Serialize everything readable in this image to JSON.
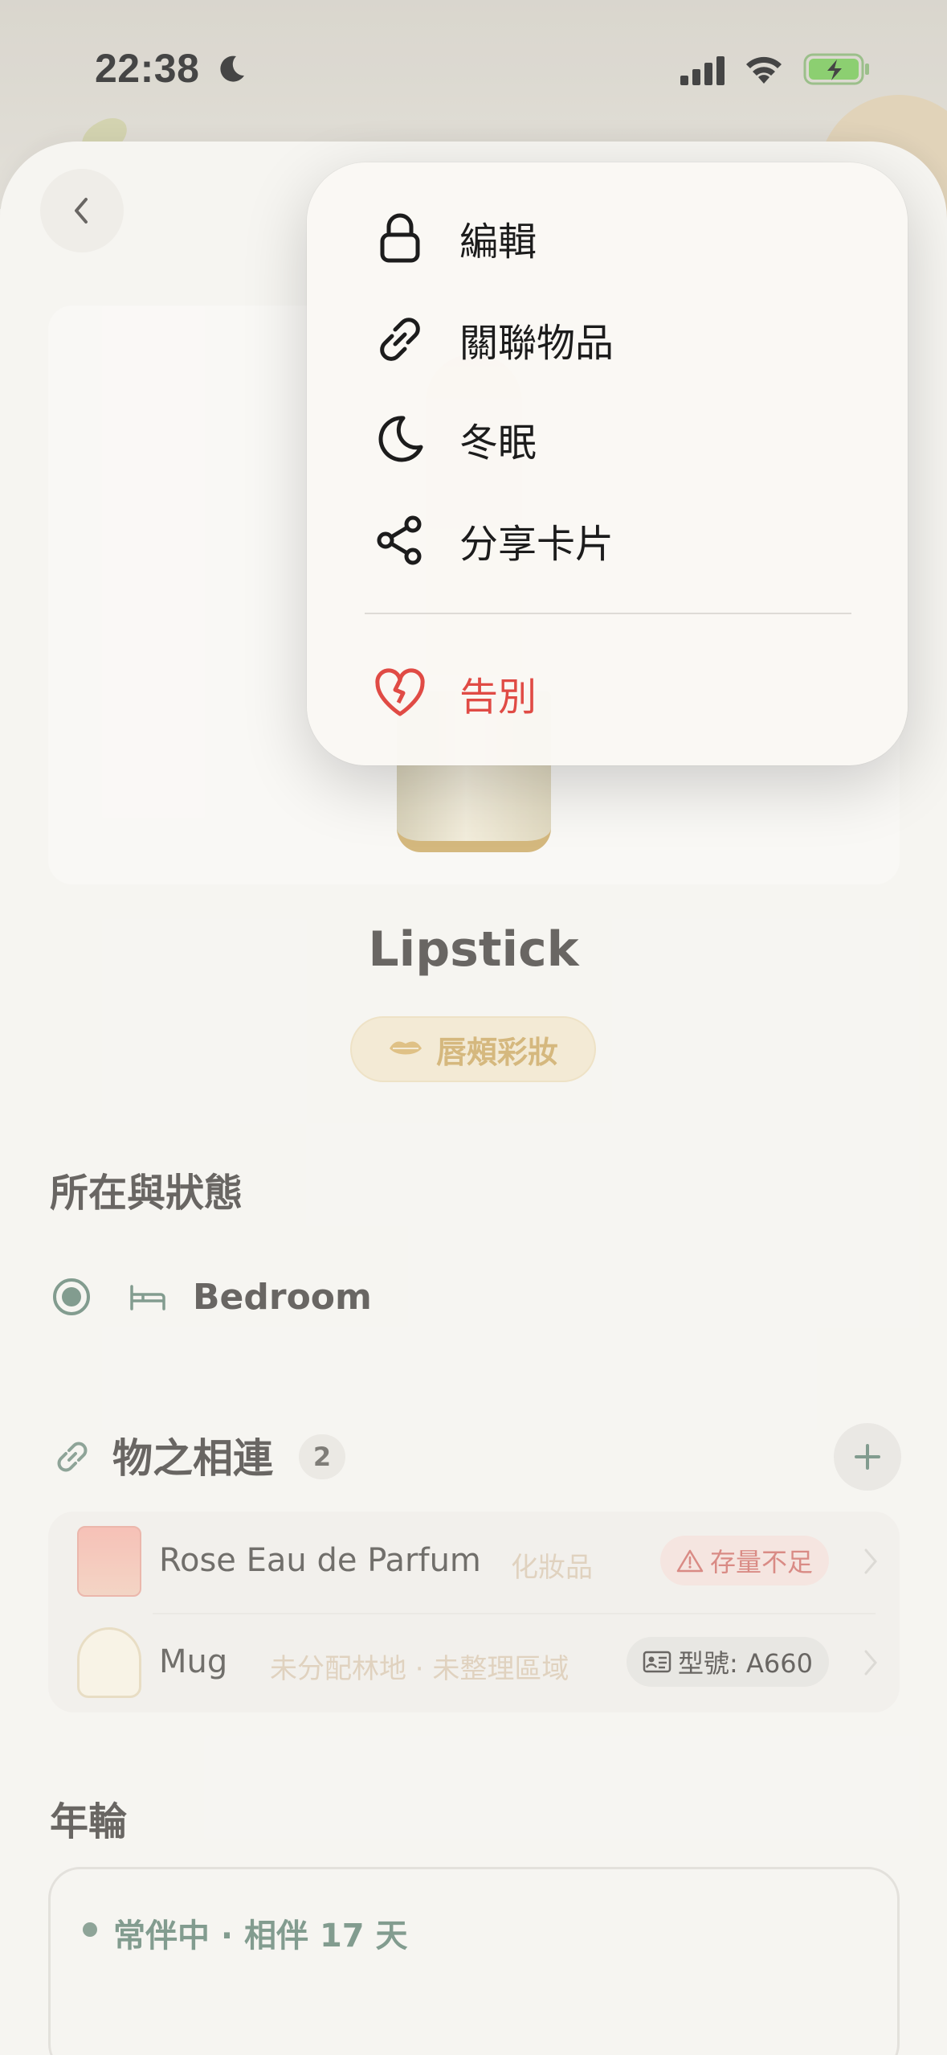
{
  "status_bar": {
    "time": "22:38"
  },
  "item": {
    "title": "Lipstick",
    "category": "唇頰彩妝"
  },
  "location_section": {
    "title": "所在與狀態",
    "room": "Bedroom"
  },
  "links_section": {
    "title": "物之相連",
    "count": "2",
    "items": [
      {
        "name": "Rose Eau de Parfum",
        "meta": "化妝品",
        "tag": "存量不足",
        "tag_icon": "warning-icon"
      },
      {
        "name": "Mug",
        "meta": "未分配林地 · 未整理區域",
        "tag": "型號: A660",
        "tag_icon": "id-card-icon"
      }
    ]
  },
  "rings_section": {
    "title": "年輪",
    "status": "常伴中 · 相伴 17 天"
  },
  "menu": {
    "items": [
      {
        "label": "編輯",
        "icon": "lock-icon"
      },
      {
        "label": "關聯物品",
        "icon": "link-icon"
      },
      {
        "label": "冬眠",
        "icon": "moon-icon"
      },
      {
        "label": "分享卡片",
        "icon": "share-icon"
      },
      {
        "label": "告別",
        "icon": "broken-heart-icon"
      }
    ]
  },
  "colors": {
    "accent_green": "#5f8070",
    "danger_red": "#e04b45",
    "category_gold": "#c9a55a"
  }
}
